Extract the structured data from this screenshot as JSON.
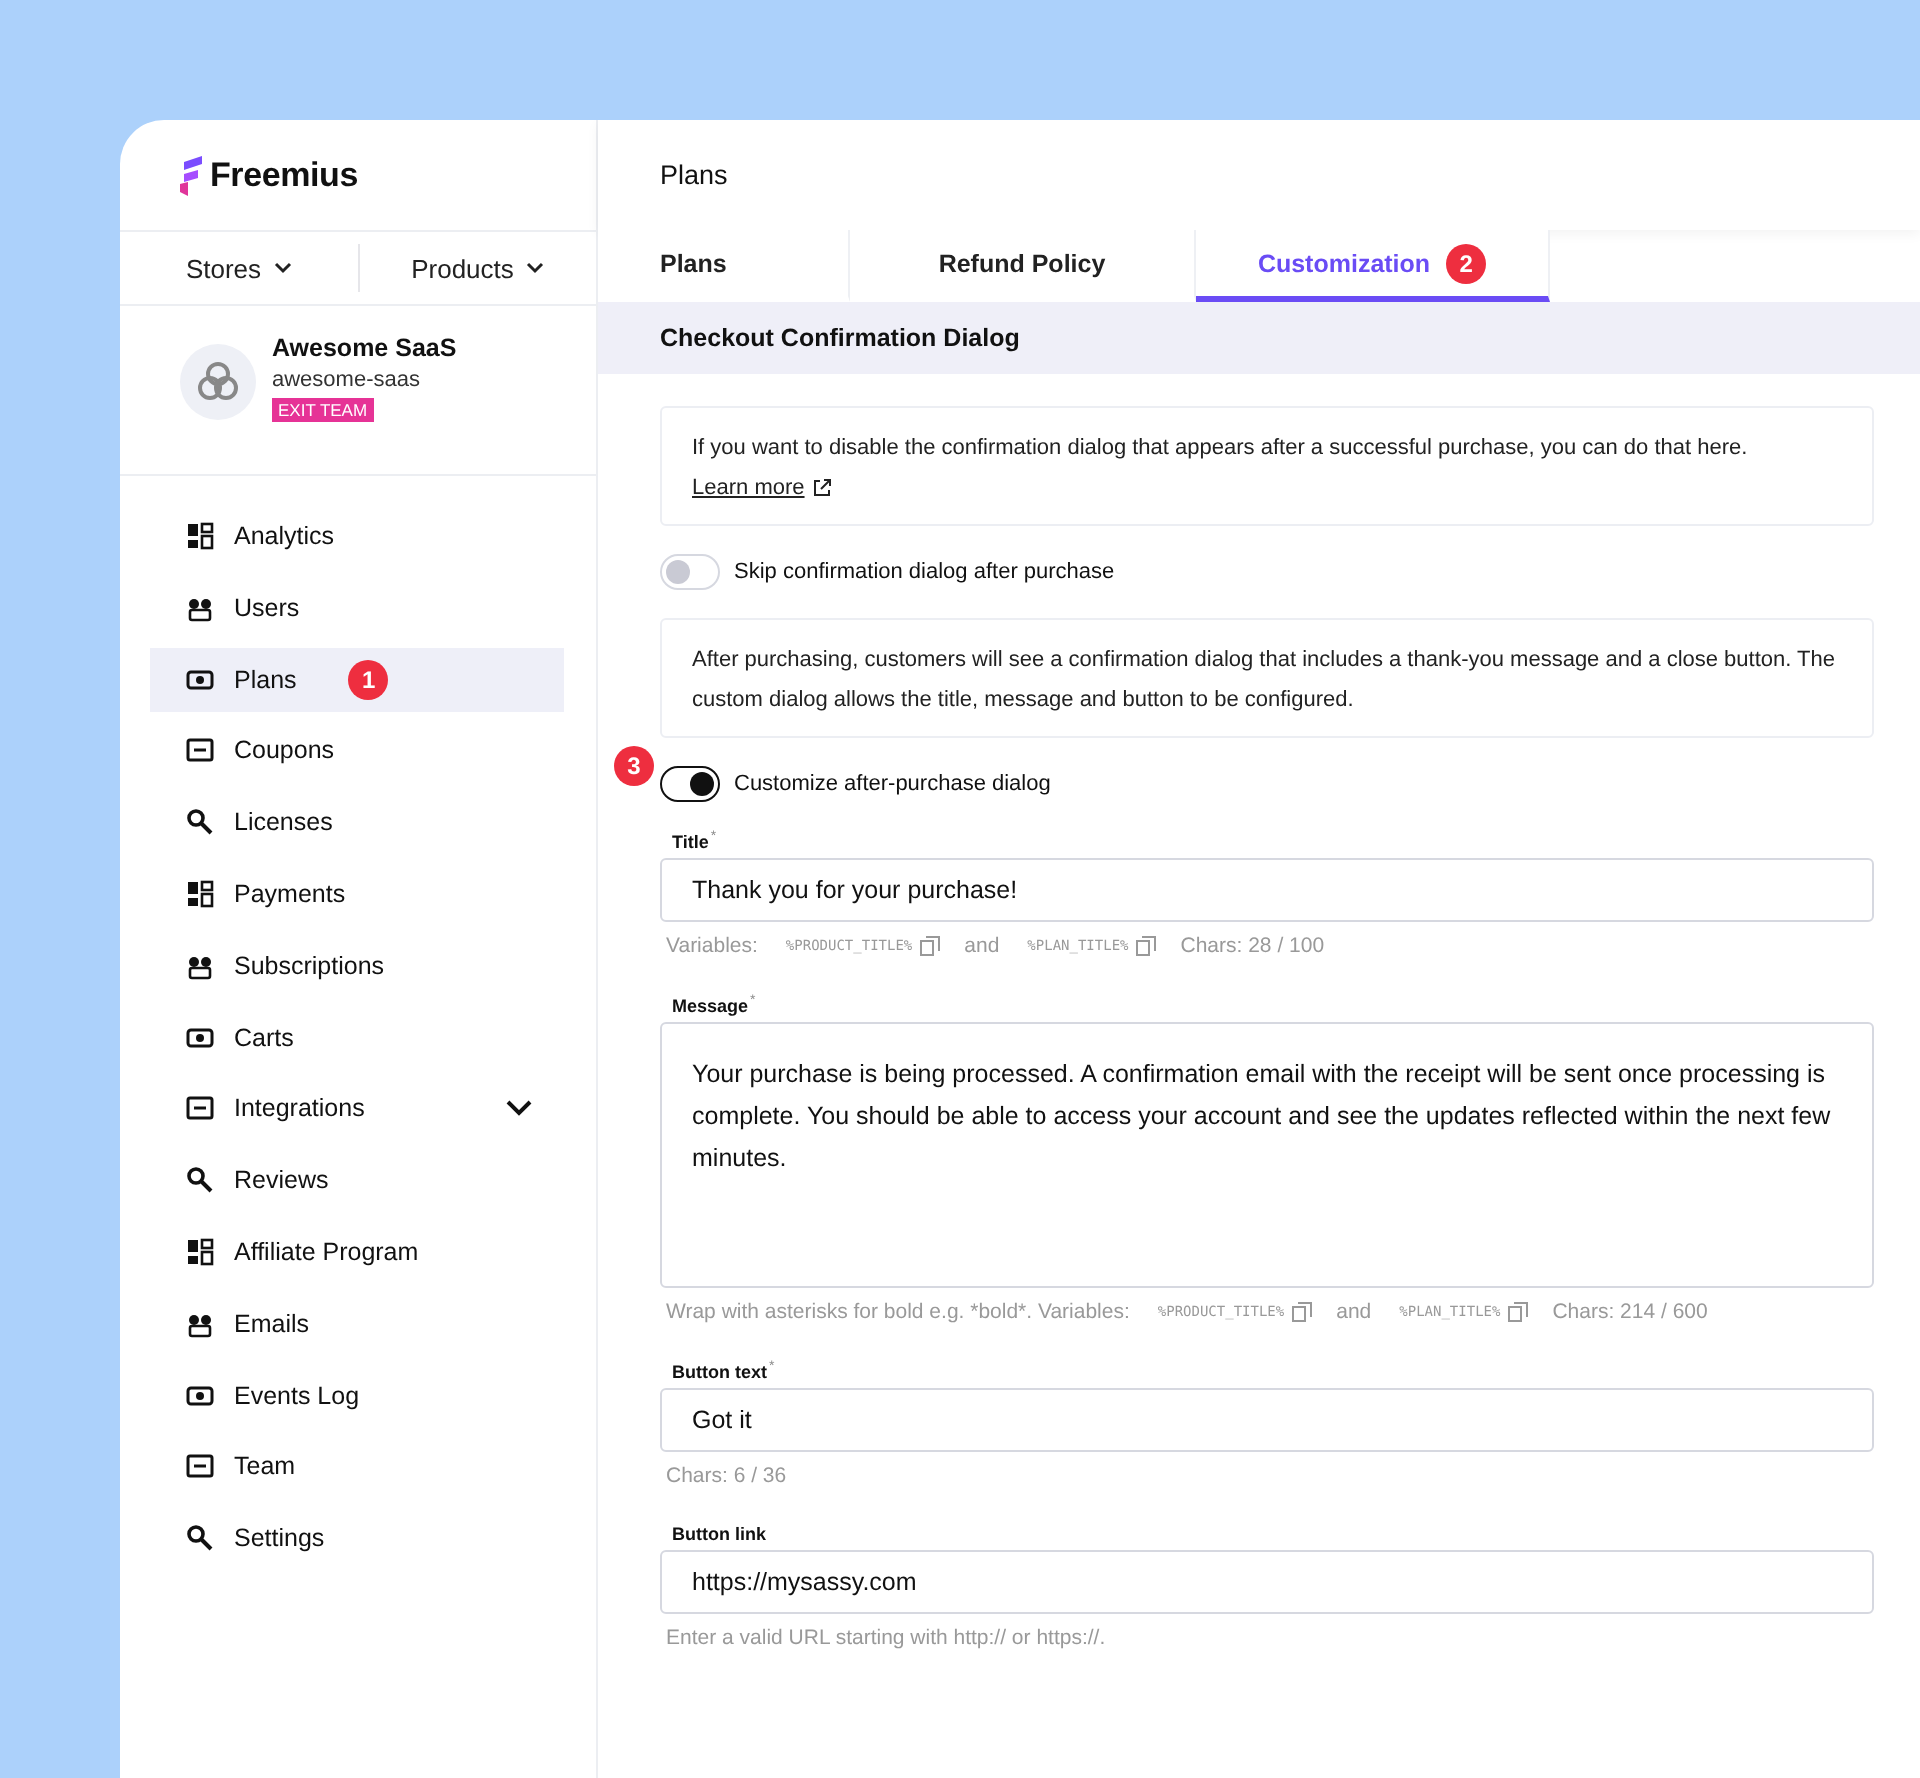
{
  "brand": {
    "name": "Freemius"
  },
  "switchers": [
    {
      "label": "Stores"
    },
    {
      "label": "Products"
    }
  ],
  "team": {
    "name": "Awesome SaaS",
    "slug": "awesome-saas",
    "action": "EXIT TEAM"
  },
  "nav": [
    {
      "label": "Analytics",
      "selected": false
    },
    {
      "label": "Users",
      "selected": false
    },
    {
      "label": "Plans",
      "selected": true,
      "badge": "1"
    },
    {
      "label": "Coupons",
      "selected": false
    },
    {
      "label": "Licenses",
      "selected": false
    },
    {
      "label": "Payments",
      "selected": false
    },
    {
      "label": "Subscriptions",
      "selected": false
    },
    {
      "label": "Carts",
      "selected": false
    },
    {
      "label": "Integrations",
      "selected": false,
      "expandable": true
    },
    {
      "label": "Reviews",
      "selected": false
    },
    {
      "label": "Affiliate Program",
      "selected": false
    },
    {
      "label": "Emails",
      "selected": false
    },
    {
      "label": "Events Log",
      "selected": false
    },
    {
      "label": "Team",
      "selected": false
    },
    {
      "label": "Settings",
      "selected": false
    }
  ],
  "page_title": "Plans",
  "tabs": [
    {
      "label": "Plans",
      "selected": false
    },
    {
      "label": "Refund Policy",
      "selected": false
    },
    {
      "label": "Customization",
      "selected": true,
      "badge": "2"
    }
  ],
  "section_title": "Checkout Confirmation Dialog",
  "blocks": [
    {
      "kind": "note",
      "text": "If you want to disable the confirmation dialog that appears after a successful purchase, you can do that here.",
      "link": "Learn more"
    },
    {
      "kind": "toggle",
      "label": "Skip confirmation dialog after purchase",
      "on": false
    },
    {
      "kind": "note",
      "text": "After purchasing, customers will see a confirmation dialog that includes a thank-you message and a close button. The custom dialog allows the title, message and button to be configured."
    },
    {
      "kind": "toggle",
      "label": "Customize after-purchase dialog",
      "on": true,
      "badge": "3"
    },
    {
      "kind": "field",
      "label": "Title",
      "required_mark": "*",
      "value": "Thank you for your purchase!",
      "hint": [
        {
          "kind": "text",
          "text": "Variables:"
        },
        {
          "kind": "var",
          "text": "%PRODUCT_TITLE%"
        },
        {
          "kind": "text",
          "text": "and"
        },
        {
          "kind": "var",
          "text": "%PLAN_TITLE%"
        },
        {
          "kind": "text",
          "text": "Chars: 28 / 100"
        }
      ]
    },
    {
      "kind": "textarea",
      "label": "Message",
      "required_mark": "*",
      "value": "Your purchase is being processed. A confirmation email with the receipt will be sent once processing is complete. You should be able to access your account and see the updates reflected within the next few minutes.",
      "hint": [
        {
          "kind": "text",
          "text": "Wrap with asterisks for bold e.g. *bold*. Variables:"
        },
        {
          "kind": "var",
          "text": "%PRODUCT_TITLE%"
        },
        {
          "kind": "text",
          "text": "and"
        },
        {
          "kind": "var",
          "text": "%PLAN_TITLE%"
        },
        {
          "kind": "text",
          "text": "Chars: 214 / 600"
        }
      ]
    },
    {
      "kind": "field",
      "label": "Button text",
      "required_mark": "*",
      "value": "Got it",
      "hint": [
        {
          "kind": "text",
          "text": "Chars: 6 / 36"
        }
      ]
    },
    {
      "kind": "field",
      "label": "Button link",
      "value": "https://mysassy.com",
      "hint": [
        {
          "kind": "text",
          "text": "Enter a valid URL starting with http:// or https://."
        }
      ]
    }
  ]
}
